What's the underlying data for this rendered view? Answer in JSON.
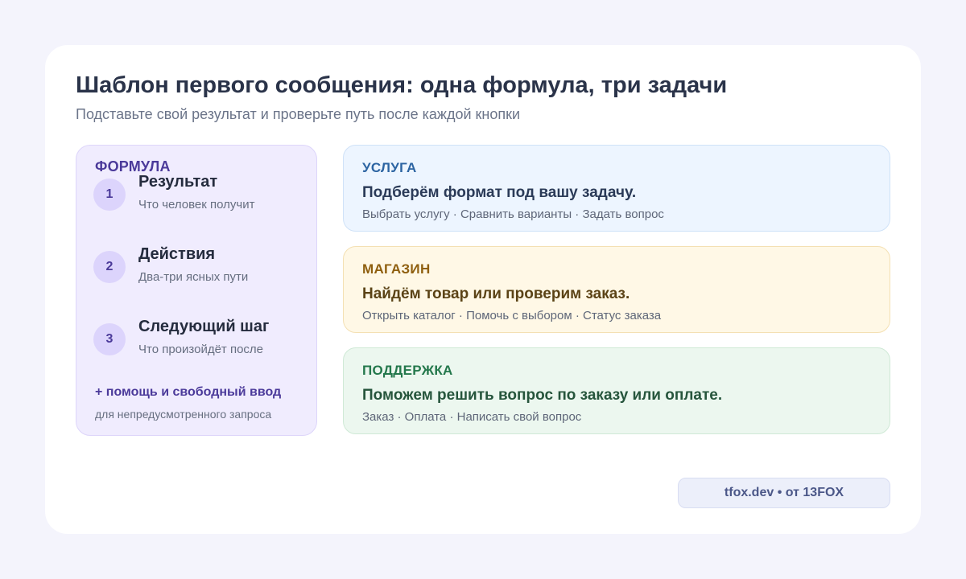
{
  "header": {
    "title": "Шаблон первого сообщения: одна формула, три задачи",
    "subtitle": "Подставьте свой результат и проверьте путь после каждой кнопки"
  },
  "formula": {
    "label": "ФОРМУЛА",
    "steps": [
      {
        "num": "1",
        "title": "Результат",
        "desc": "Что человек получит"
      },
      {
        "num": "2",
        "title": "Действия",
        "desc": "Два-три ясных пути"
      },
      {
        "num": "3",
        "title": "Следующий шаг",
        "desc": "Что произойдёт после"
      }
    ],
    "extra_title": "+ помощь и свободный ввод",
    "extra_desc": "для непредусмотренного запроса"
  },
  "scenarios": [
    {
      "tag": "УСЛУГА",
      "message": "Подберём формат под вашу задачу.",
      "paths": "Выбрать услугу · Сравнить варианты · Задать вопрос",
      "accent": "#2c64a2"
    },
    {
      "tag": "МАГАЗИН",
      "message": "Найдём товар или проверим заказ.",
      "paths": "Открыть каталог · Помочь с выбором · Статус заказа",
      "accent": "#8f5f0f"
    },
    {
      "tag": "ПОДДЕРЖКА",
      "message": "Поможем решить вопрос по заказу или оплате.",
      "paths": "Заказ · Оплата · Написать свой вопрос",
      "accent": "#24784c"
    }
  ],
  "footer": {
    "badge": "tfox.dev • от 13FOX"
  },
  "colors": {
    "background": "#f4f4fc",
    "card": "#ffffff",
    "formula_bg": "#f0ecfe",
    "formula_accent": "#4b3a9a"
  }
}
